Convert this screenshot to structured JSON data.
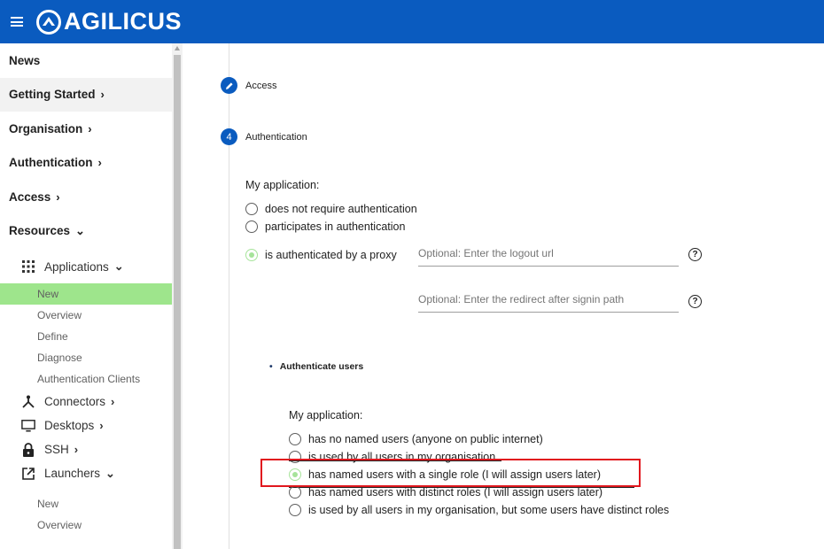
{
  "header": {
    "app_name": "AGILICUS",
    "brand_color": "#0a5bbf"
  },
  "sidebar": {
    "items": [
      {
        "label": "News"
      },
      {
        "label": "Getting Started"
      },
      {
        "label": "Organisation"
      },
      {
        "label": "Authentication"
      },
      {
        "label": "Access"
      },
      {
        "label": "Resources"
      }
    ],
    "applications": {
      "label": "Applications",
      "icon": "grid-icon",
      "children": [
        "New",
        "Overview",
        "Define",
        "Diagnose",
        "Authentication Clients"
      ]
    },
    "connectors": {
      "label": "Connectors",
      "icon": "network-icon"
    },
    "desktops": {
      "label": "Desktops",
      "icon": "monitor-icon"
    },
    "ssh": {
      "label": "SSH",
      "icon": "lock-icon"
    },
    "launchers": {
      "label": "Launchers",
      "icon": "launch-icon",
      "children": [
        "New",
        "Overview"
      ]
    },
    "active_item": "New",
    "active_color": "#9ee58c"
  },
  "main": {
    "steps": [
      {
        "label": "Access",
        "state": "edit"
      },
      {
        "label": "Authentication",
        "number": "4"
      }
    ],
    "auth_section": {
      "prompt": "My application:",
      "options": [
        "does not require authentication",
        "participates in authentication",
        "is authenticated by a proxy"
      ],
      "selected": "is authenticated by a proxy",
      "logout_placeholder": "Optional: Enter the logout url",
      "redirect_placeholder": "Optional: Enter the redirect after signin path"
    },
    "users_section": {
      "heading": "Authenticate users",
      "prompt": "My application:",
      "options": [
        "has no named users (anyone on public internet)",
        "is used by all users in my organisation",
        "has named users with a single role (I will assign users later)",
        "has named users with distinct roles (I will assign users later)",
        "is used by all users in my organisation, but some users have distinct roles"
      ],
      "selected": "has named users with a single role (I will assign users later)",
      "highlight_color": "#e1171e"
    }
  }
}
